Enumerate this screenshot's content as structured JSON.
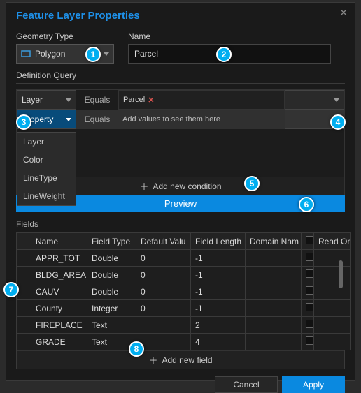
{
  "window": {
    "title": "Feature Layer Properties"
  },
  "geometry": {
    "label": "Geometry Type",
    "value": "Polygon"
  },
  "nameField": {
    "label": "Name",
    "value": "Parcel"
  },
  "definitionQuery": {
    "heading": "Definition Query",
    "rows": [
      {
        "type": "Layer",
        "op": "Equals",
        "tag": "Parcel",
        "placeholder": ""
      },
      {
        "type": "Property",
        "op": "Equals",
        "tag": "",
        "placeholder": "Add values to see them here"
      }
    ],
    "dropdownOptions": [
      "Layer",
      "Color",
      "LineType",
      "LineWeight"
    ],
    "addCondition": "Add new condition",
    "preview": "Preview"
  },
  "fields": {
    "heading": "Fields",
    "columns": [
      "Name",
      "Field Type",
      "Default Value",
      "Field Length",
      "Domain Name",
      "Read Only"
    ],
    "columnsShort": [
      "Name",
      "Field Type",
      "Default Valu",
      "Field Length",
      "Domain Nam",
      "Read On"
    ],
    "rows": [
      {
        "name": "APPR_TOT",
        "type": "Double",
        "default": "0",
        "length": "-1",
        "domain": "",
        "readonly": false
      },
      {
        "name": "BLDG_AREA",
        "type": "Double",
        "default": "0",
        "length": "-1",
        "domain": "",
        "readonly": false
      },
      {
        "name": "CAUV",
        "type": "Double",
        "default": "0",
        "length": "-1",
        "domain": "",
        "readonly": false
      },
      {
        "name": "County",
        "type": "Integer",
        "default": "0",
        "length": "-1",
        "domain": "",
        "readonly": false
      },
      {
        "name": "FIREPLACE",
        "type": "Text",
        "default": "",
        "length": "2",
        "domain": "",
        "readonly": false
      },
      {
        "name": "GRADE",
        "type": "Text",
        "default": "",
        "length": "4",
        "domain": "",
        "readonly": false
      }
    ],
    "addField": "Add new field"
  },
  "footer": {
    "cancel": "Cancel",
    "apply": "Apply"
  },
  "badges": [
    "1",
    "2",
    "3",
    "4",
    "5",
    "6",
    "7",
    "8"
  ]
}
